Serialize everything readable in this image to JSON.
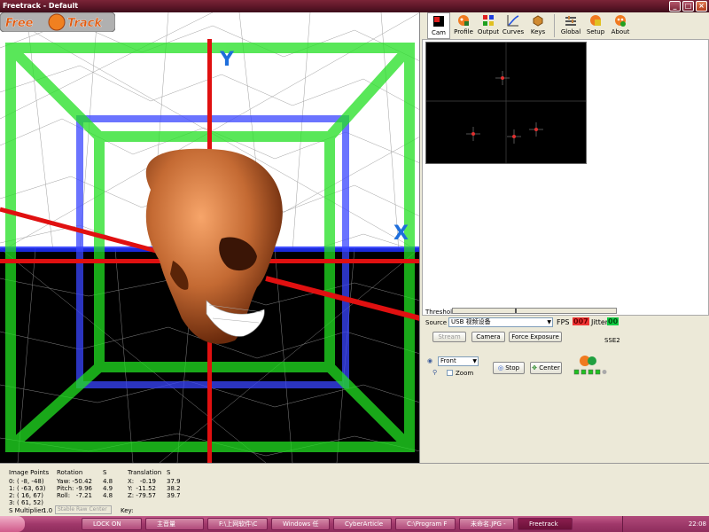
{
  "window": {
    "title": "Freetrack - Default"
  },
  "logo": {
    "text": "FreeTrack"
  },
  "viewport": {
    "axis_y_label": "Y",
    "axis_x_label": "X"
  },
  "toolbar": {
    "items": [
      {
        "label": "Cam",
        "icon": "camera-icon"
      },
      {
        "label": "Profile",
        "icon": "profile-icon"
      },
      {
        "label": "Output",
        "icon": "output-icon"
      },
      {
        "label": "Curves",
        "icon": "curves-icon"
      },
      {
        "label": "Keys",
        "icon": "keys-icon"
      },
      {
        "label": "Global",
        "icon": "global-icon"
      },
      {
        "label": "Setup",
        "icon": "setup-icon"
      },
      {
        "label": "About",
        "icon": "about-icon"
      }
    ]
  },
  "camera": {
    "threshold_label": "Threshold",
    "source_label": "Source",
    "source_value": "USB 视频设备",
    "fps_label": "FPS",
    "fps_value": "007",
    "jitter_label": "Jitter",
    "jitter_value": "00",
    "stream_label": "Stream",
    "camera_label": "Camera",
    "force_exposure_label": "Force Exposure",
    "sse_label": "SSE2"
  },
  "view_controls": {
    "view_select": "Front",
    "zoom_label": "Zoom",
    "stop_label": "Stop",
    "center_label": "Center"
  },
  "image_points": {
    "header": "Image Points",
    "rows": [
      "0: ( -8, -48)",
      "1: ( -63, 63)",
      "2: ( 16, 67)",
      "3: ( 61, 52)"
    ]
  },
  "rotation": {
    "header": "Rotation",
    "s_header": "S",
    "rows": [
      {
        "label": "Yaw:",
        "value": "-50.42",
        "s": "4.8"
      },
      {
        "label": "Pitch:",
        "value": "-9.96",
        "s": "4.9"
      },
      {
        "label": "Roll:",
        "value": "-7.21",
        "s": "4.8"
      }
    ]
  },
  "translation": {
    "header": "Translation",
    "s_header": "S",
    "rows": [
      {
        "label": "X:",
        "value": "-0.19",
        "s": "37.9"
      },
      {
        "label": "Y:",
        "value": "-11.52",
        "s": "38.2"
      },
      {
        "label": "Z:",
        "value": "-79.57",
        "s": "39.7"
      }
    ]
  },
  "footer": {
    "s_multiplier_label": "S Multiplier:",
    "s_multiplier_value": "1.0",
    "stable": "Stable",
    "raw": "Raw",
    "center": "Center",
    "key_label": "Key:"
  },
  "taskbar": {
    "tasks": [
      {
        "label": "LOCK ON"
      },
      {
        "label": "主音量"
      },
      {
        "label": "F:\\上网软件\\C"
      },
      {
        "label": "Windows 任"
      },
      {
        "label": "CyberArticle"
      },
      {
        "label": "C:\\Program F"
      },
      {
        "label": "未命名.JPG -"
      },
      {
        "label": "Freetrack"
      }
    ],
    "clock": "22:08"
  }
}
